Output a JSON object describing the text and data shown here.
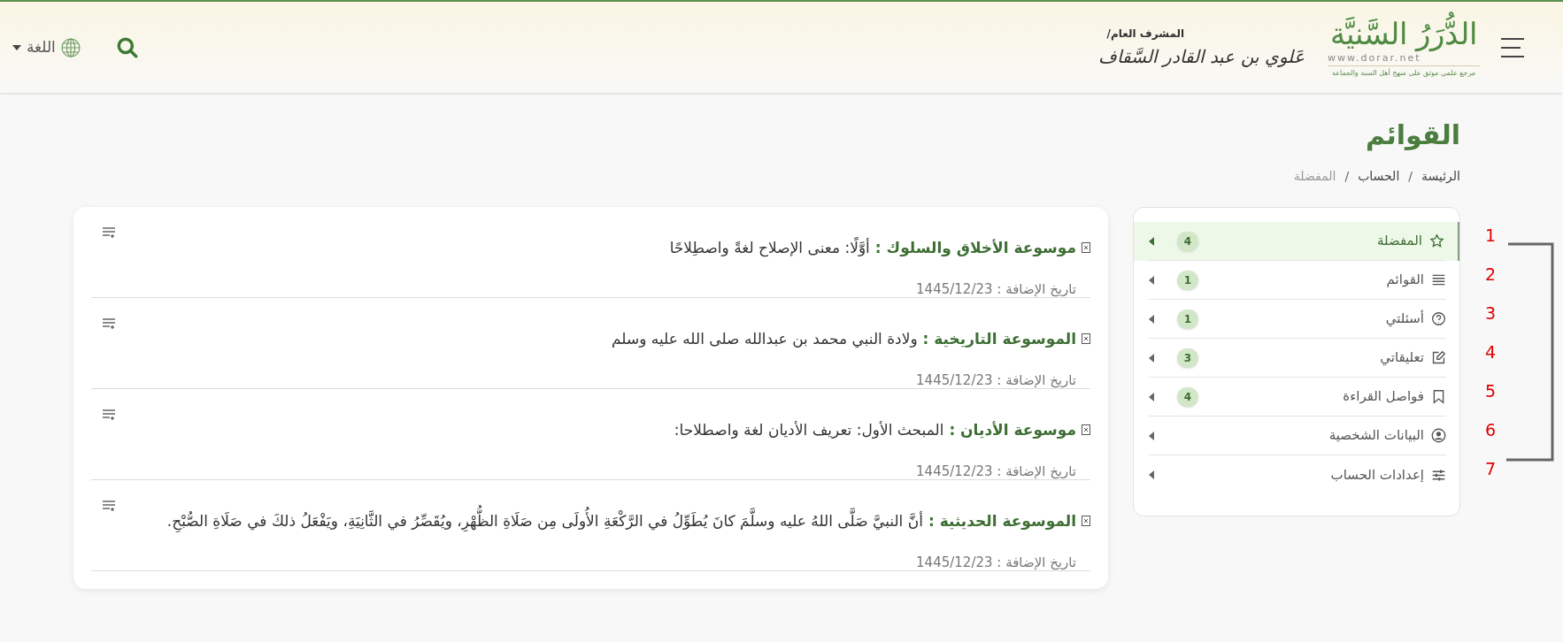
{
  "header": {
    "logo": {
      "title": "الدُّرَرُ السَّنيَّة",
      "url": "www.dorar.net",
      "tagline": "مرجع علمي موثق على منهج أهل السنة والجماعة"
    },
    "supervisor": {
      "label": "المشرف العام/",
      "name": "عَلوي بن عبد القادر السَّقاف"
    },
    "language": {
      "label": "اللغة"
    }
  },
  "page_title": "القوائم",
  "breadcrumb": [
    {
      "label": "الرئيسة",
      "current": false
    },
    {
      "separator": "/",
      "label": "الحساب",
      "current": false
    },
    {
      "separator": "/",
      "label": "المفضلة",
      "current": true
    }
  ],
  "sidebar": {
    "items": [
      {
        "label": "المفضلة",
        "kind": "star",
        "count": "4",
        "selected": true
      },
      {
        "label": "القوائم",
        "kind": "list",
        "count": "1",
        "selected": false
      },
      {
        "label": "أسئلتي",
        "kind": "question",
        "count": "1",
        "selected": false
      },
      {
        "label": "تعليقاتي",
        "kind": "edit",
        "count": "3",
        "selected": false
      },
      {
        "label": "فواصل القراءة",
        "kind": "bookmark",
        "count": "4",
        "selected": false
      },
      {
        "label": "البيانات الشخصية",
        "kind": "user",
        "selected": false
      },
      {
        "label": "إعدادات الحساب",
        "kind": "sliders",
        "selected": false
      }
    ]
  },
  "favorites": [
    {
      "source": "موسوعة الأخلاق والسلوك :",
      "text": "أوَّلًا: معنى الإصلاح لغةً واصطِلاحًا",
      "date": "تاريخ الإضافة : 1445/12/23"
    },
    {
      "source": "الموسوعة التاريخية :",
      "text": "ولادة النبي محمد بن عبدالله صلى الله عليه وسلم",
      "date": "تاريخ الإضافة : 1445/12/23"
    },
    {
      "source": "موسوعة الأديان :",
      "text": "المبحث الأول: تعريف الأديان لغة واصطلاحا:",
      "date": "تاريخ الإضافة : 1445/12/23"
    },
    {
      "source": "الموسوعة الحديثية :",
      "text": "أنَّ النبيَّ صَلَّى اللهُ عليه وسلَّمَ كانَ يُطَوِّلُ في الرَّكْعَةِ الأُولَى مِن صَلَاةِ الظُّهْرِ، ويُقَصِّرُ في الثَّانِيَةِ، ويَفْعَلُ ذلكَ في صَلَاةِ الصُّبْحِ.",
      "date": "تاريخ الإضافة : 1445/12/23"
    }
  ],
  "annotation_labels": [
    "1",
    "2",
    "3",
    "4",
    "5",
    "6",
    "7"
  ]
}
